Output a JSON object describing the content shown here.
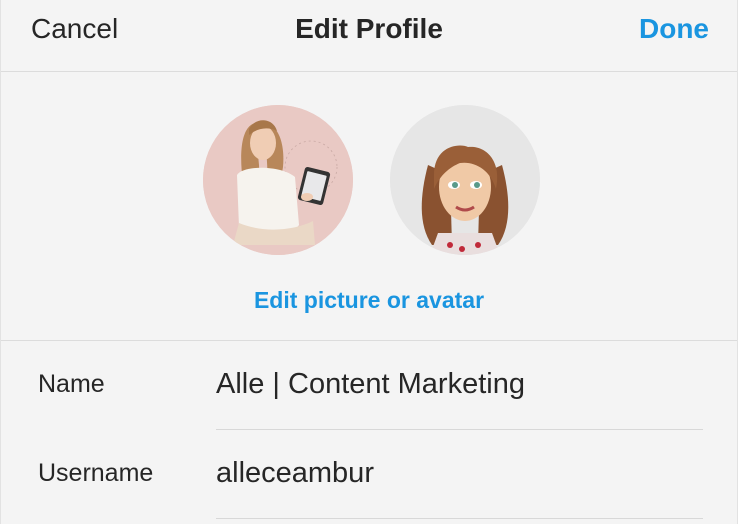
{
  "header": {
    "cancel_label": "Cancel",
    "title": "Edit Profile",
    "done_label": "Done"
  },
  "profile_picture": {
    "edit_label": "Edit picture or avatar"
  },
  "fields": {
    "name": {
      "label": "Name",
      "value": "Alle | Content Marketing"
    },
    "username": {
      "label": "Username",
      "value": "alleceambur"
    }
  },
  "colors": {
    "accent": "#1a95e0",
    "background": "#f4f4f4",
    "divider": "#dcdcdc"
  }
}
